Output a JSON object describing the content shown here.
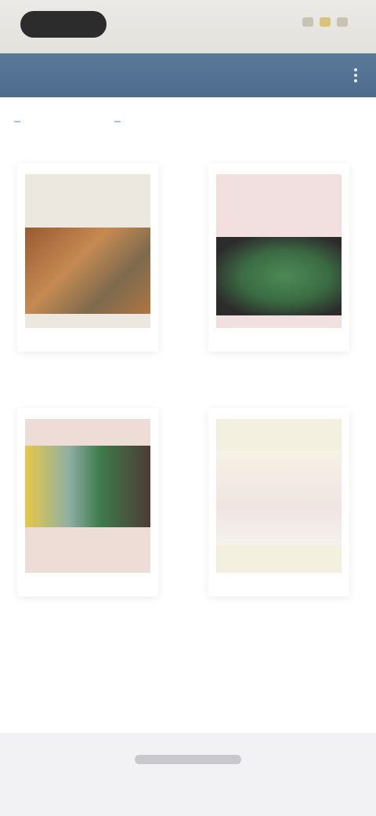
{
  "status_bar": {
    "icons": [
      "signal-icon",
      "wifi-icon",
      "battery-icon"
    ]
  },
  "app_bar": {
    "title": "",
    "menu_icon": "more-vert-icon",
    "color": "#50708f"
  },
  "tabs": [
    {
      "label": ""
    },
    {
      "label": ""
    }
  ],
  "cards": [
    {
      "caption": "",
      "thumbnail_colors": [
        "#ece7df",
        "#b47a4a",
        "#fafaf4"
      ]
    },
    {
      "caption": "",
      "thumbnail_colors": [
        "#f2dfe0",
        "#3f6b4a",
        "#f4eee8"
      ]
    },
    {
      "caption": "",
      "thumbnail_colors": [
        "#eedcd7",
        "#7fa36a",
        "#f2ecec"
      ]
    },
    {
      "caption": "",
      "thumbnail_colors": [
        "#f3f0df",
        "#f4f2ee",
        "#efe8e6"
      ]
    }
  ]
}
